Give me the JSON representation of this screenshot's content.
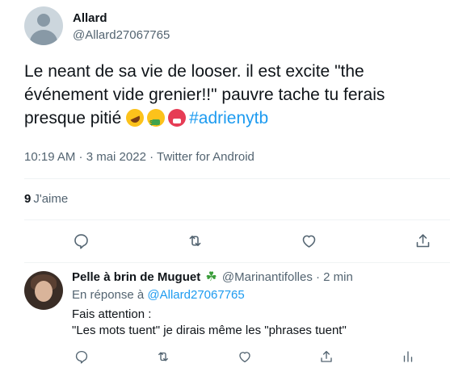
{
  "main_tweet": {
    "author": {
      "display_name": "Allard",
      "handle": "@Allard27067765"
    },
    "text": {
      "line1": "Le neant de sa vie de looser. il est excite \"the",
      "line2": "événement vide grenier!!\" pauvre tache tu ferais",
      "line3_prefix": "presque pitié ",
      "hashtag": "#adrienytb",
      "emojis": [
        "rolling-on-floor-laughing",
        "money-mouth-face",
        "hot-face"
      ]
    },
    "meta": "10:19 AM · 3 mai 2022 · Twitter for Android",
    "stats": {
      "likes_count": "9",
      "likes_label": "J'aime"
    },
    "actions": [
      "reply-icon",
      "retweet-icon",
      "like-icon",
      "share-icon"
    ]
  },
  "reply_tweet": {
    "author": {
      "display_name": "Pelle à brin de Muguet",
      "badge_icon": "four-leaf-clover-icon",
      "handle": "@Marinantifolles",
      "separator": "·",
      "time": "2 min"
    },
    "context": {
      "prefix": "En réponse à ",
      "mention": "@Allard27067765"
    },
    "body": {
      "line1": "Fais attention :",
      "line2": "\"Les mots tuent\" je dirais même les \"phrases tuent\""
    },
    "actions": [
      "reply-icon",
      "retweet-icon",
      "like-icon",
      "share-icon",
      "analytics-icon"
    ]
  },
  "colors": {
    "text_primary": "#0f1419",
    "text_secondary": "#536471",
    "accent": "#1d9bf0",
    "divider": "#eff3f4"
  }
}
